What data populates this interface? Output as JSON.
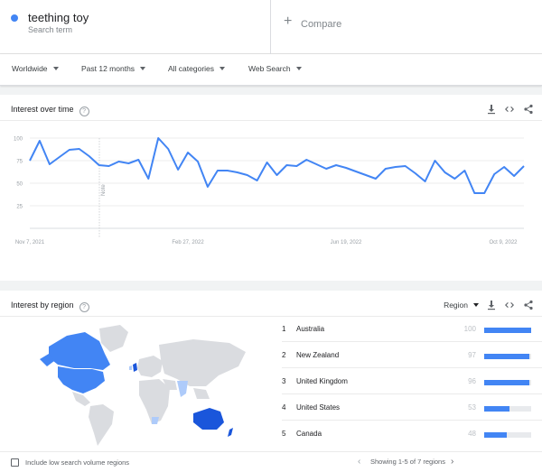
{
  "search_term": {
    "name": "teething toy",
    "sublabel": "Search term",
    "color": "#4285f4"
  },
  "compare": {
    "label": "Compare",
    "icon": "plus-icon"
  },
  "filters": [
    {
      "label": "Worldwide"
    },
    {
      "label": "Past 12 months"
    },
    {
      "label": "All categories"
    },
    {
      "label": "Web Search"
    }
  ],
  "interest_over_time": {
    "title": "Interest over time",
    "tools": [
      "download-icon",
      "embed-icon",
      "share-icon"
    ]
  },
  "chart_data": {
    "type": "line",
    "y_ticks": [
      100,
      75,
      50,
      25
    ],
    "ylim": [
      0,
      100
    ],
    "x_labels": [
      "Nov 7, 2021",
      "Feb 27, 2022",
      "Jun 19, 2022",
      "Oct 9, 2022"
    ],
    "note_label": "Note",
    "series": [
      {
        "color": "#4285f4",
        "values": [
          75,
          97,
          71,
          79,
          87,
          88,
          80,
          70,
          69,
          74,
          72,
          76,
          55,
          100,
          88,
          65,
          84,
          74,
          46,
          64,
          64,
          62,
          59,
          53,
          73,
          59,
          70,
          69,
          76,
          71,
          66,
          70,
          67,
          63,
          59,
          55,
          66,
          68,
          69,
          61,
          52,
          75,
          62,
          55,
          64,
          39,
          39,
          60,
          68,
          58,
          69
        ]
      }
    ]
  },
  "interest_by_region": {
    "title": "Interest by region",
    "selector_label": "Region",
    "tools": [
      "download-icon",
      "embed-icon",
      "share-icon"
    ],
    "rows": [
      {
        "rank": "1",
        "name": "Australia",
        "value": 100
      },
      {
        "rank": "2",
        "name": "New Zealand",
        "value": 97
      },
      {
        "rank": "3",
        "name": "United Kingdom",
        "value": 96
      },
      {
        "rank": "4",
        "name": "United States",
        "value": 53
      },
      {
        "rank": "5",
        "name": "Canada",
        "value": 48
      }
    ],
    "colors": {
      "high": "#1a56db",
      "mid": "#4285f4",
      "low": "#aecbfa",
      "none": "#dadce0"
    }
  },
  "footer": {
    "checkbox_label": "Include low search volume regions",
    "pager_text": "Showing 1-5 of 7 regions"
  }
}
